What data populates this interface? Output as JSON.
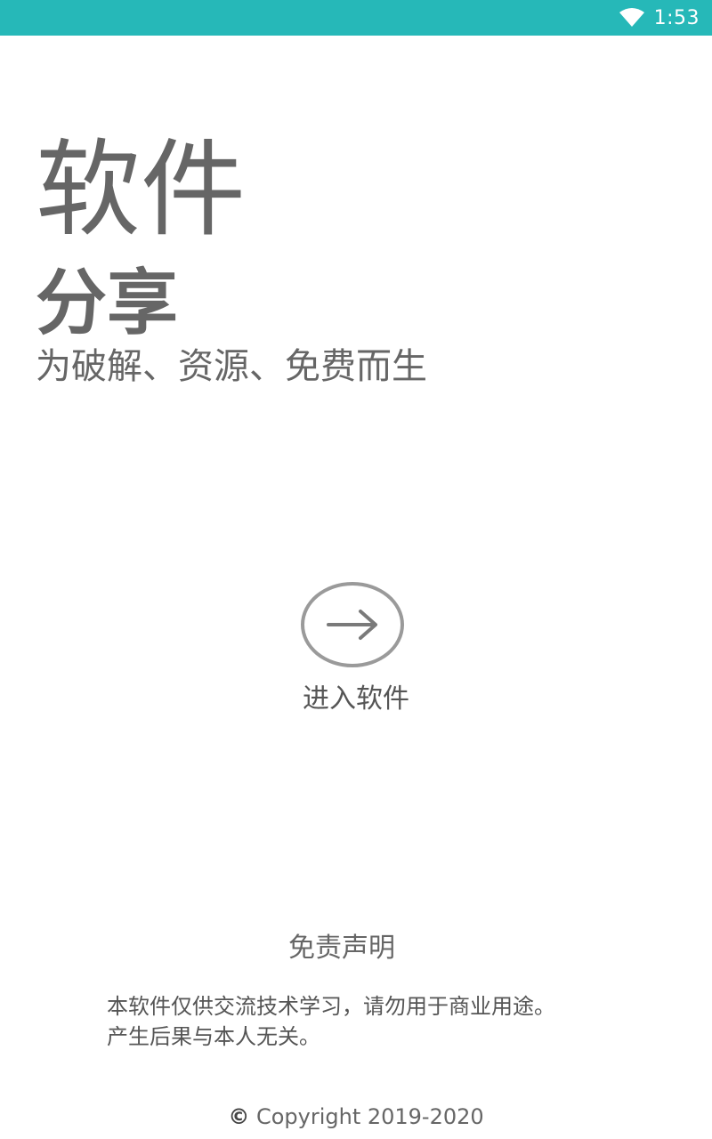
{
  "status_bar": {
    "time": "1:53",
    "background": "#26b8b8",
    "icons": [
      "wifi-icon"
    ]
  },
  "hero": {
    "title": "软件",
    "subtitle": "分享",
    "tagline": "为破解、资源、免费而生",
    "text_color": "#666666"
  },
  "enter": {
    "icon": "arrow-right-icon",
    "label": "进入软件"
  },
  "disclaimer": {
    "title": "免责声明",
    "lines": [
      "本软件仅供交流技术学习，请勿用于商业用途。",
      "产生后果与本人无关。"
    ]
  },
  "footer": {
    "copyright_symbol": "©",
    "copyright_text": "Copyright 2019-2020"
  }
}
